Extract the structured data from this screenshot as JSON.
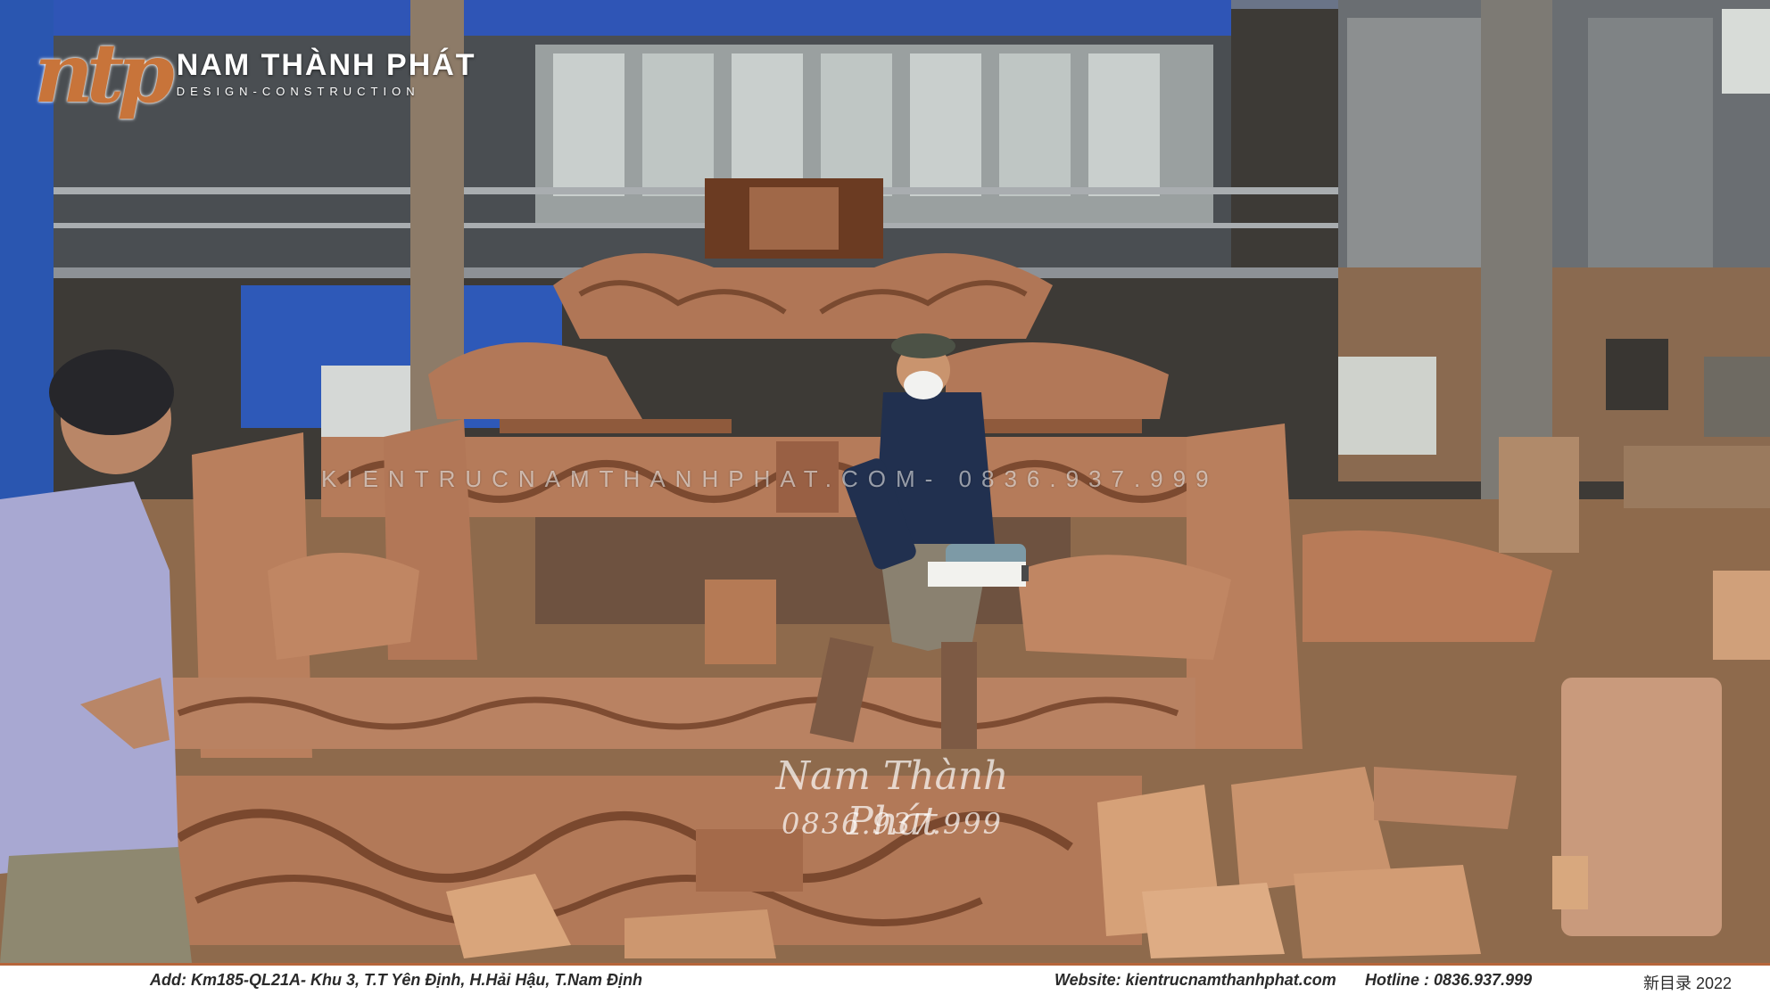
{
  "logo": {
    "mark": "ntp",
    "brand": "NAM THÀNH PHÁT",
    "tagline": "DESIGN-CONSTRUCTION"
  },
  "watermark": {
    "line": "KIENTRUCNAMTHANHPHAT.COM- 0836.937.999",
    "signature": "Nam Thành Phát",
    "phone": "0836.937.999"
  },
  "footer": {
    "address": "Add: Km185-QL21A- Khu 3, T.T Yên Định, H.Hải Hậu, T.Nam Định",
    "website": "Website: kientrucnamthanhphat.com",
    "hotline": "Hotline : 0836.937.999",
    "extra": "新目录 2022"
  },
  "colors": {
    "brand_orange": "#c8743a",
    "wood": "#b77a55",
    "footer_bg": "#ffffff"
  }
}
